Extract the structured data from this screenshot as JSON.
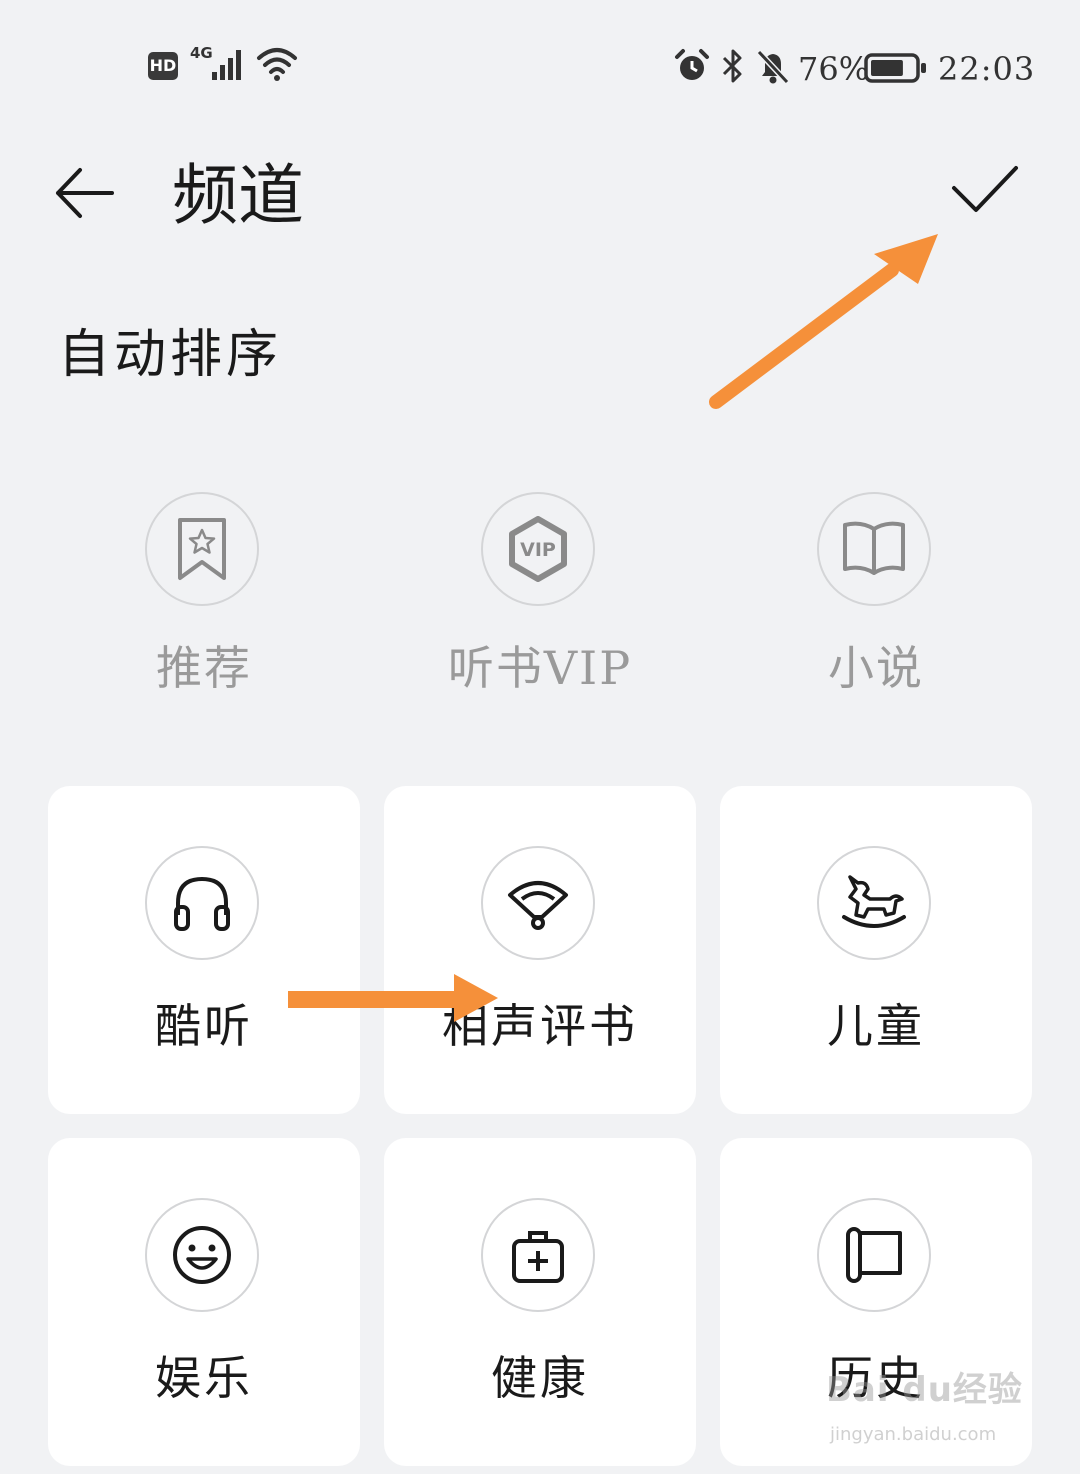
{
  "status_bar": {
    "hd": "HD",
    "network": "4G",
    "battery_percent": "76%",
    "battery_level": 0.76,
    "time": "22:03",
    "icons": [
      "signal-icon",
      "wifi-icon",
      "alarm-icon",
      "bluetooth-icon",
      "mute-icon",
      "battery-icon"
    ]
  },
  "header": {
    "title": "频道",
    "back_icon": "back-arrow-icon",
    "confirm_icon": "check-icon"
  },
  "auto_sort_label": "自动排序",
  "fixed_channels": [
    {
      "label": "推荐",
      "icon": "bookmark-star-icon"
    },
    {
      "label": "听书VIP",
      "icon": "vip-badge-icon"
    },
    {
      "label": "小说",
      "icon": "open-book-icon"
    }
  ],
  "channels": [
    {
      "label": "酷听",
      "icon": "headphones-icon"
    },
    {
      "label": "相声评书",
      "icon": "fan-icon"
    },
    {
      "label": "儿童",
      "icon": "rocking-horse-icon"
    },
    {
      "label": "娱乐",
      "icon": "smiley-icon"
    },
    {
      "label": "健康",
      "icon": "medical-kit-icon"
    },
    {
      "label": "历史",
      "icon": "scroll-icon"
    }
  ],
  "watermark": {
    "brand": "Bai du经验",
    "url": "jingyan.baidu.com"
  },
  "colors": {
    "background": "#f1f2f4",
    "card": "#ffffff",
    "annotation_arrow": "#f5903a",
    "muted_text": "#9a9a9a"
  }
}
